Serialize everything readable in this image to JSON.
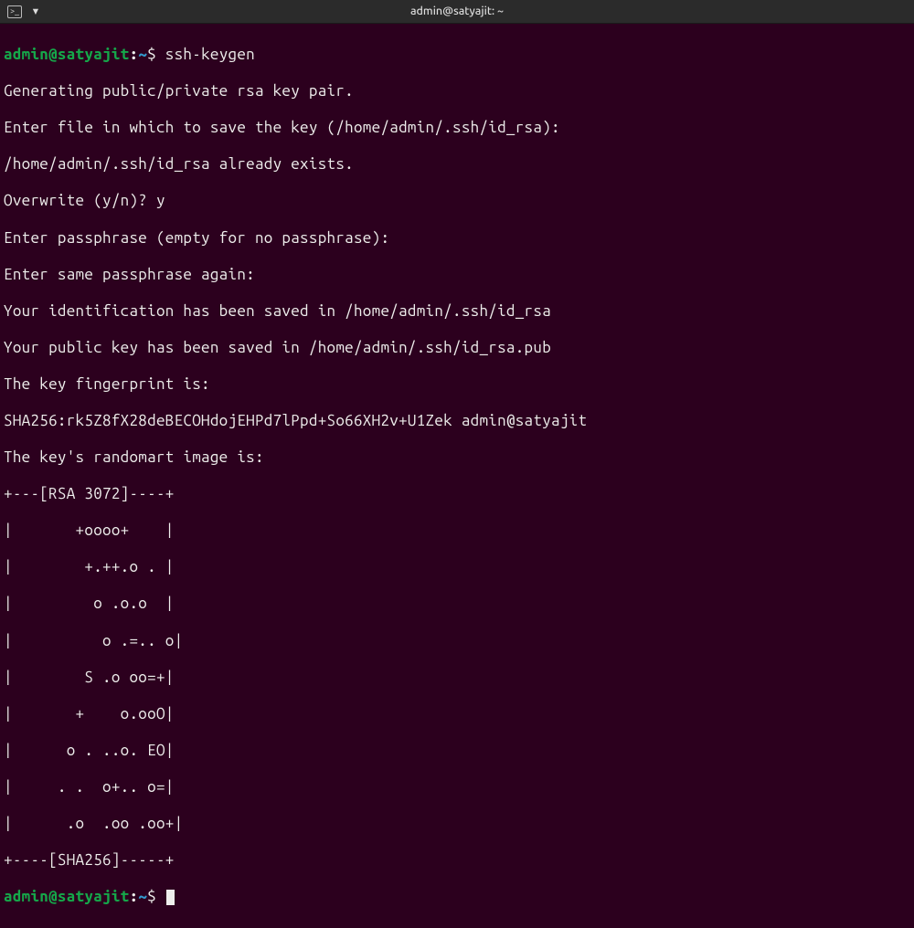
{
  "titlebar": {
    "title": "admin@satyajit: ~",
    "new_tab_glyph": "▾"
  },
  "prompt": {
    "user_host": "admin@satyajit",
    "path": "~",
    "symbol": "$"
  },
  "command": "ssh-keygen",
  "output": [
    "Generating public/private rsa key pair.",
    "Enter file in which to save the key (/home/admin/.ssh/id_rsa):",
    "/home/admin/.ssh/id_rsa already exists.",
    "Overwrite (y/n)? y",
    "Enter passphrase (empty for no passphrase):",
    "Enter same passphrase again:",
    "Your identification has been saved in /home/admin/.ssh/id_rsa",
    "Your public key has been saved in /home/admin/.ssh/id_rsa.pub",
    "The key fingerprint is:",
    "SHA256:rk5Z8fX28deBECOHdojEHPd7lPpd+So66XH2v+U1Zek admin@satyajit",
    "The key's randomart image is:",
    "+---[RSA 3072]----+",
    "|       +oooo+    |",
    "|        +.++.o . |",
    "|         o .o.o  |",
    "|          o .=.. o|",
    "|        S .o oo=+|",
    "|       +    o.ooO|",
    "|      o . ..o. EO|",
    "|     . .  o+.. o=|",
    "|      .o  .oo .oo+|",
    "+----[SHA256]-----+"
  ]
}
